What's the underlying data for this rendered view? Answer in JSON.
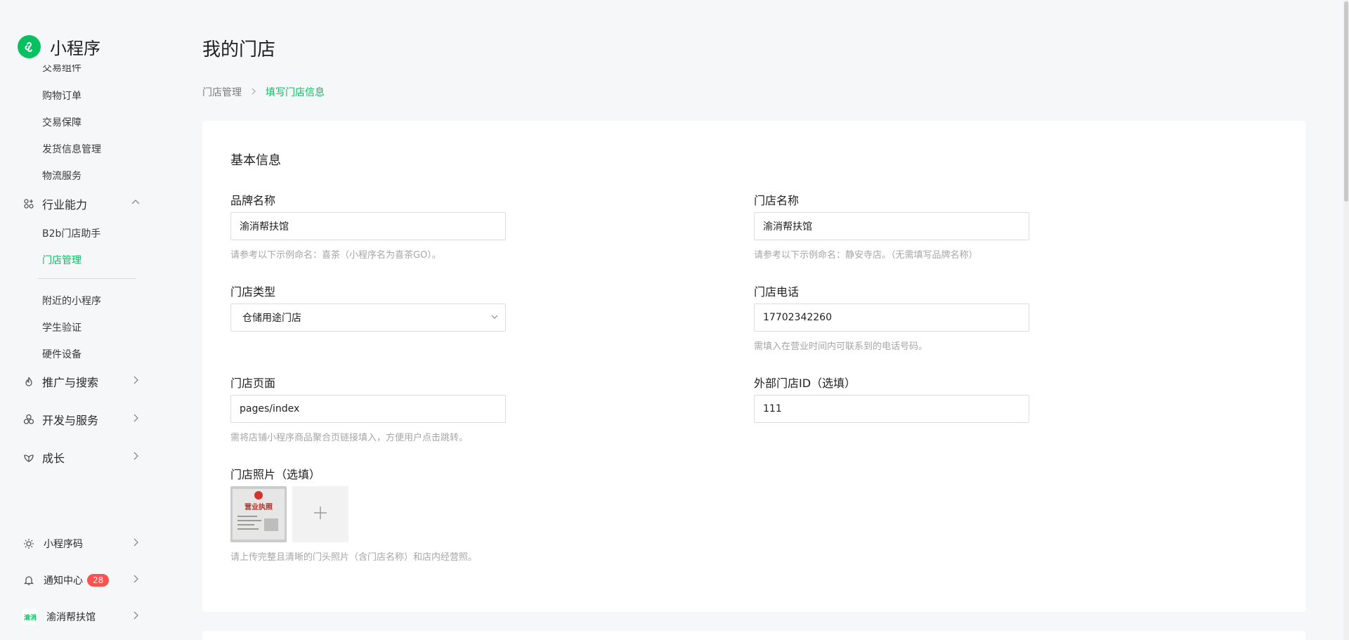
{
  "colors": {
    "accent": "#07c160",
    "badge": "#fa5151",
    "hint": "#a6a6a6"
  },
  "app": {
    "name": "小程序"
  },
  "sidebar": {
    "partial_item": "交易组件",
    "items_top": [
      {
        "label": "购物订单"
      },
      {
        "label": "交易保障"
      },
      {
        "label": "发货信息管理"
      },
      {
        "label": "物流服务"
      }
    ],
    "group_industry": {
      "label": "行业能力",
      "icon": "industry-icon",
      "expanded": true
    },
    "industry_items": [
      {
        "label": "B2b门店助手"
      },
      {
        "label": "门店管理",
        "active": true
      }
    ],
    "items_after": [
      {
        "label": "附近的小程序"
      },
      {
        "label": "学生验证"
      },
      {
        "label": "硬件设备"
      }
    ],
    "groups": [
      {
        "label": "推广与搜索",
        "icon": "flame-icon"
      },
      {
        "label": "开发与服务",
        "icon": "cluster-icon"
      },
      {
        "label": "成长",
        "icon": "leaf-icon"
      }
    ],
    "bottom": {
      "qrcode": {
        "label": "小程序码",
        "icon": "sun-icon"
      },
      "notifications": {
        "label": "通知中心",
        "count": "28",
        "icon": "bell-icon"
      },
      "account": {
        "label": "渝消帮扶馆",
        "avatar_text": "渝消"
      }
    }
  },
  "page": {
    "title": "我的门店",
    "breadcrumb": [
      "门店管理",
      "填写门店信息"
    ]
  },
  "form": {
    "section_title": "基本信息",
    "brand_name": {
      "label": "品牌名称",
      "value": "渝消帮扶馆",
      "hint": "请参考以下示例命名：喜茶（小程序名为喜茶GO）。"
    },
    "store_name": {
      "label": "门店名称",
      "value": "渝消帮扶馆",
      "hint": "请参考以下示例命名：静安寺店。（无需填写品牌名称）"
    },
    "store_type": {
      "label": "门店类型",
      "value": "仓储用途门店"
    },
    "store_phone": {
      "label": "门店电话",
      "value": "17702342260",
      "hint": "需填入在营业时间内可联系到的电话号码。"
    },
    "store_page": {
      "label": "门店页面",
      "value": "pages/index",
      "hint": "需将店铺小程序商品聚合页链接填入，方便用户点击跳转。"
    },
    "external_id": {
      "label": "外部门店ID（选填）",
      "value": "111"
    },
    "photos": {
      "label": "门店照片（选填）",
      "hint": "请上传完整且清晰的门头照片（含门店名称）和店内经营照。",
      "thumb_text": "营业执照"
    }
  }
}
